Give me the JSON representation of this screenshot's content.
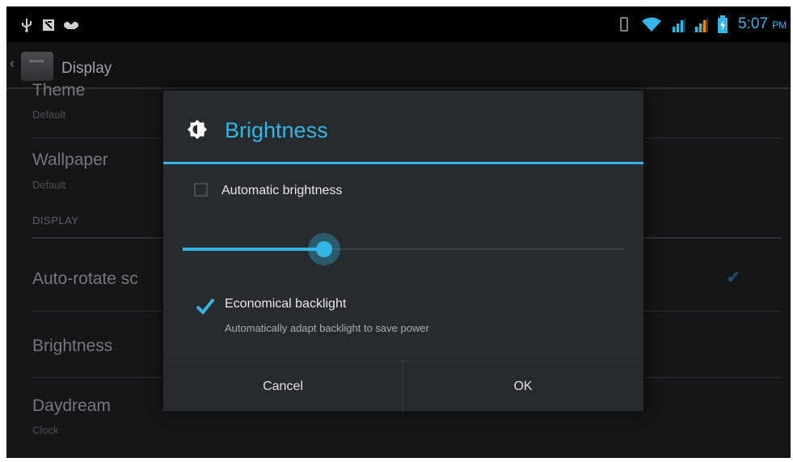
{
  "status_bar": {
    "time": "5:07",
    "time_suffix": "PM",
    "left_icons": [
      "usb-icon",
      "notification-icon",
      "voicemail-icon"
    ],
    "right_icons": [
      "vibrate-icon",
      "wifi-icon",
      "signal-icon",
      "signal-icon",
      "battery-icon"
    ],
    "accent_color": "#33b5e5"
  },
  "action_bar": {
    "title": "Display"
  },
  "settings": {
    "items": [
      {
        "title": "Theme",
        "summary": "Default"
      },
      {
        "title": "Wallpaper",
        "summary": "Default"
      },
      {
        "title": "Auto-rotate sc",
        "summary": ""
      },
      {
        "title": "Brightness",
        "summary": ""
      },
      {
        "title": "Daydream",
        "summary": "Clock"
      }
    ],
    "section_header": "DISPLAY",
    "auto_rotate_checked": true
  },
  "dialog": {
    "title": "Brightness",
    "icon": "brightness-icon",
    "automatic_brightness": {
      "label": "Automatic brightness",
      "checked": false
    },
    "brightness_level": 0.32,
    "economical_backlight": {
      "label": "Economical backlight",
      "summary": "Automatically adapt backlight to save power",
      "checked": true
    },
    "buttons": {
      "cancel": "Cancel",
      "ok": "OK"
    }
  }
}
